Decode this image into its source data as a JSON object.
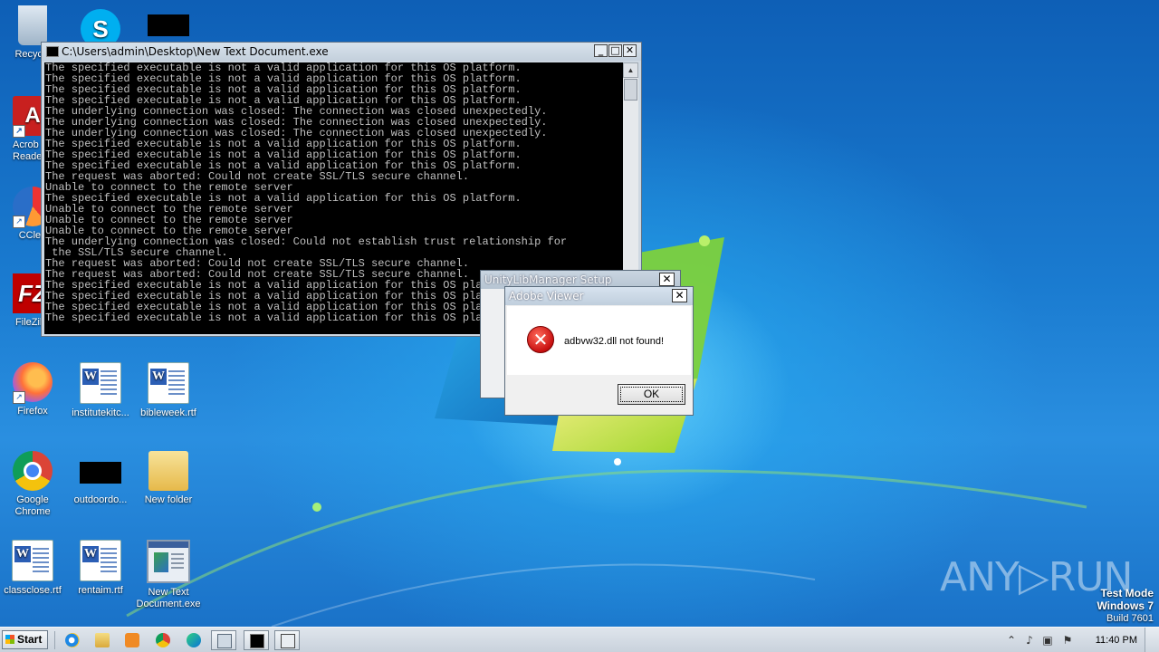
{
  "desktop_icons": {
    "recycle": "Recycle",
    "skype": "",
    "black_top": "",
    "acrobat": "Acrob Reader",
    "ccleaner": "CClea",
    "filezilla": "FileZilla",
    "firefox": "Firefox",
    "instituteki": "institutekitc...",
    "bibleweek": "bibleweek.rtf",
    "chrome": "Google Chrome",
    "outdoordo": "outdoordo...",
    "newfolder": "New folder",
    "classclose": "classclose.rtf",
    "rentaim": "rentaim.rtf",
    "newtextexe": "New Text Document.exe"
  },
  "console": {
    "title": "C:\\Users\\admin\\Desktop\\New Text Document.exe",
    "lines": [
      "The specified executable is not a valid application for this OS platform.",
      "The specified executable is not a valid application for this OS platform.",
      "The specified executable is not a valid application for this OS platform.",
      "The specified executable is not a valid application for this OS platform.",
      "The underlying connection was closed: The connection was closed unexpectedly.",
      "The underlying connection was closed: The connection was closed unexpectedly.",
      "The underlying connection was closed: The connection was closed unexpectedly.",
      "The specified executable is not a valid application for this OS platform.",
      "The specified executable is not a valid application for this OS platform.",
      "The specified executable is not a valid application for this OS platform.",
      "The request was aborted: Could not create SSL/TLS secure channel.",
      "Unable to connect to the remote server",
      "The specified executable is not a valid application for this OS platform.",
      "Unable to connect to the remote server",
      "Unable to connect to the remote server",
      "Unable to connect to the remote server",
      "The underlying connection was closed: Could not establish trust relationship for",
      " the SSL/TLS secure channel.",
      "The request was aborted: Could not create SSL/TLS secure channel.",
      "The request was aborted: Could not create SSL/TLS secure channel.",
      "The specified executable is not a valid application for this OS platform.",
      "The specified executable is not a valid application for this OS platform.",
      "The specified executable is not a valid application for this OS platform.",
      "The specified executable is not a valid application for this OS platform."
    ]
  },
  "unity_dialog": {
    "title": "UnityLibManager Setup",
    "close": "✕"
  },
  "adobe_dialog": {
    "title": "Adobe Viewer",
    "close": "✕",
    "message": "adbvw32.dll not found!",
    "ok_label": "OK",
    "icon": "error-icon"
  },
  "watermark": {
    "brand": "ANY▷RUN",
    "test_mode": "Test Mode",
    "os": "Windows 7",
    "build": "Build 7601"
  },
  "taskbar": {
    "start_label": "Start",
    "clock": "11:40 PM",
    "pinned": [
      "internet-explorer-icon",
      "explorer-icon",
      "media-player-icon",
      "chrome-icon",
      "edge-icon",
      "console-window-icon",
      "cmd-window-icon",
      "setup-window-icon"
    ]
  },
  "colors": {
    "desktop": "#1b6fc4",
    "console_bg": "#000000",
    "console_text": "#c0c0c0",
    "error_red": "#c81010"
  }
}
